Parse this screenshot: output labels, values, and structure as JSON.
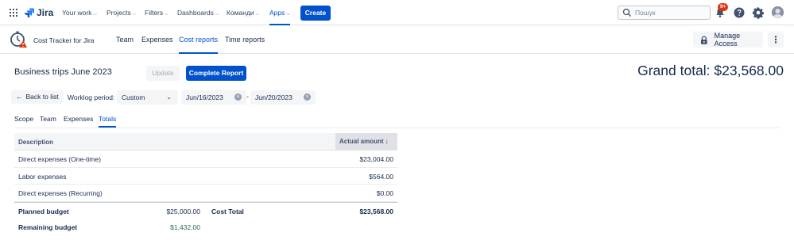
{
  "topnav": {
    "product": "Jira",
    "items": [
      {
        "label": "Your work"
      },
      {
        "label": "Projects"
      },
      {
        "label": "Filters"
      },
      {
        "label": "Dashboards"
      },
      {
        "label": "Команди"
      },
      {
        "label": "Apps"
      }
    ],
    "active_item": "Apps",
    "create_label": "Create",
    "search_placeholder": "Пошук",
    "notification_badge": "9+",
    "icons": [
      "app-switcher-icon",
      "jira-logo-icon",
      "search-icon",
      "notifications-icon",
      "help-icon",
      "settings-icon",
      "avatar"
    ],
    "colors": {
      "accent": "#0052cc",
      "badge": "#de350b"
    }
  },
  "app": {
    "name": "Cost Tracker for Jira",
    "tabs": [
      {
        "label": "Team"
      },
      {
        "label": "Expenses"
      },
      {
        "label": "Cost reports"
      },
      {
        "label": "Time reports"
      }
    ],
    "active_tab": "Cost reports",
    "manage_access_label": "Manage Access",
    "more_label": "⋮"
  },
  "report": {
    "title": "Business trips June 2023",
    "update_label": "Update",
    "complete_label": "Complete Report",
    "grand_total": "Grand total: $23,568.00"
  },
  "filters": {
    "back_label": "Back to list",
    "worklog_label": "Worklog period:",
    "period_value": "Custom",
    "date_from": "Jun/16/2023",
    "date_to": "Jun/20/2023",
    "separator": "-"
  },
  "subtabs": [
    {
      "label": "Scope"
    },
    {
      "label": "Team"
    },
    {
      "label": "Expenses"
    },
    {
      "label": "Totals"
    }
  ],
  "active_subtab": "Totals",
  "table": {
    "headers": {
      "description": "Description",
      "amount": "Actual amount ↓"
    },
    "rows": [
      {
        "description": "Direct expenses (One-time)",
        "amount": "$23,004.00"
      },
      {
        "description": "Labor expenses",
        "amount": "$564.00"
      },
      {
        "description": "Direct expenses (Recurring)",
        "amount": "$0.00"
      }
    ],
    "summary": {
      "planned_label": "Planned budget",
      "planned_value": "$25,000.00",
      "cost_total_label": "Cost Total",
      "cost_total_value": "$23,568.00",
      "remaining_label": "Remaining budget",
      "remaining_value": "$1,432.00"
    }
  }
}
